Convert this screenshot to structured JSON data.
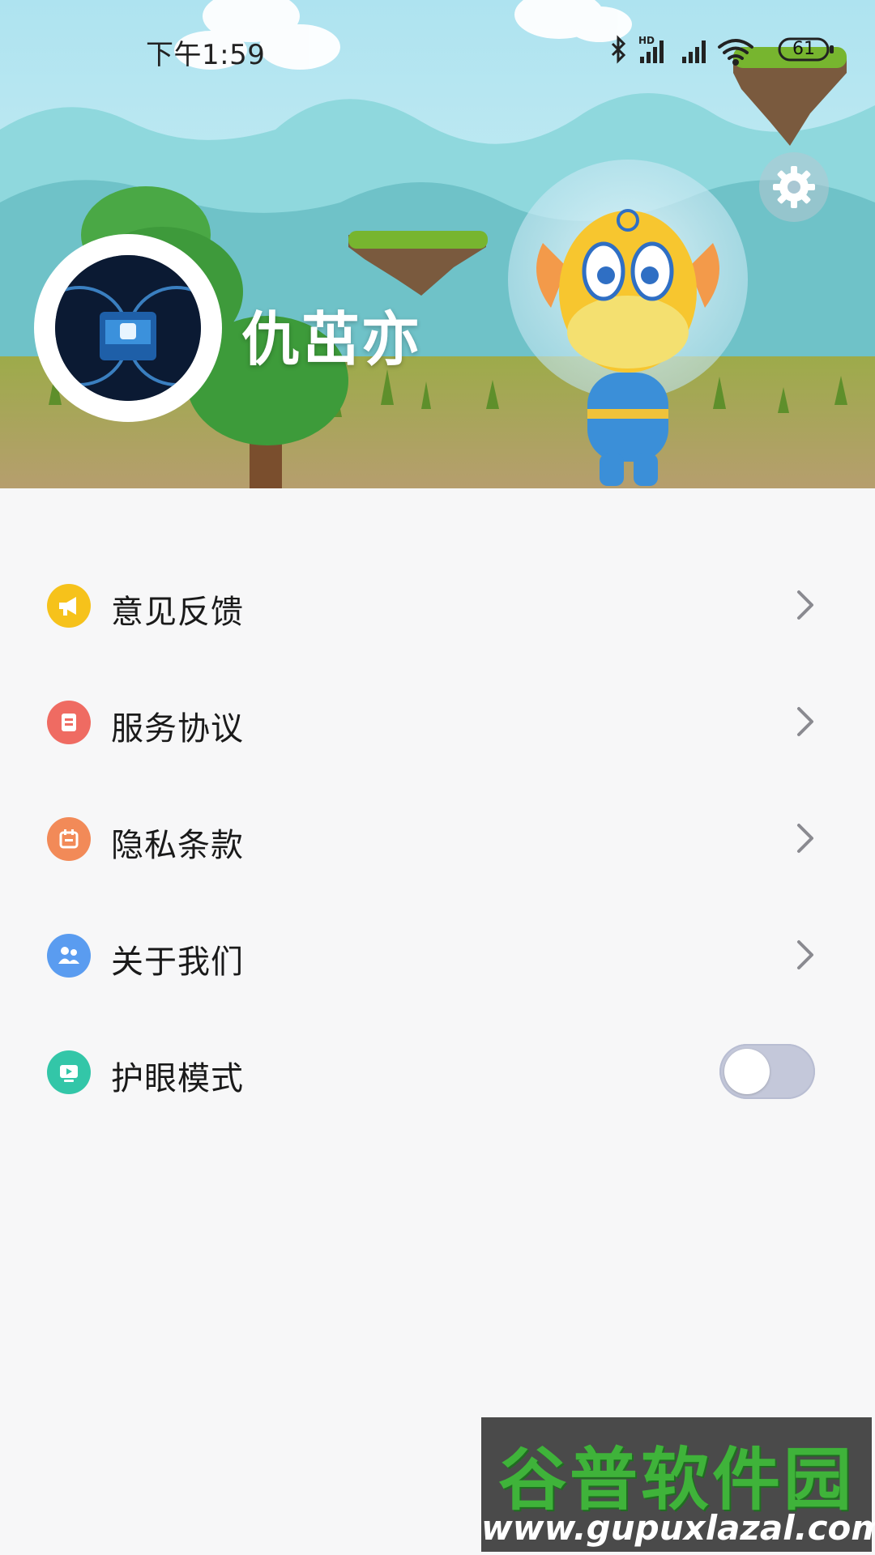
{
  "status_bar": {
    "time": "下午1:59",
    "battery": "61",
    "icons": [
      "bluetooth-icon",
      "hd-signal-icon",
      "signal-icon",
      "wifi-icon",
      "battery-icon"
    ]
  },
  "profile": {
    "username": "仇茁亦",
    "settings_icon": "gear-icon"
  },
  "menu": {
    "items": [
      {
        "label": "意见反馈",
        "icon": "megaphone-icon",
        "color": "#f6c21b"
      },
      {
        "label": "服务协议",
        "icon": "document-icon",
        "color": "#ef6b62"
      },
      {
        "label": "隐私条款",
        "icon": "calendar-icon",
        "color": "#f28a58"
      },
      {
        "label": "关于我们",
        "icon": "people-icon",
        "color": "#5a9cf0"
      },
      {
        "label": "护眼模式",
        "icon": "screen-icon",
        "color": "#33c6a8",
        "toggle": false
      }
    ]
  },
  "watermark": {
    "title": "谷普软件园",
    "url": "www.gupuxlazal.com"
  }
}
